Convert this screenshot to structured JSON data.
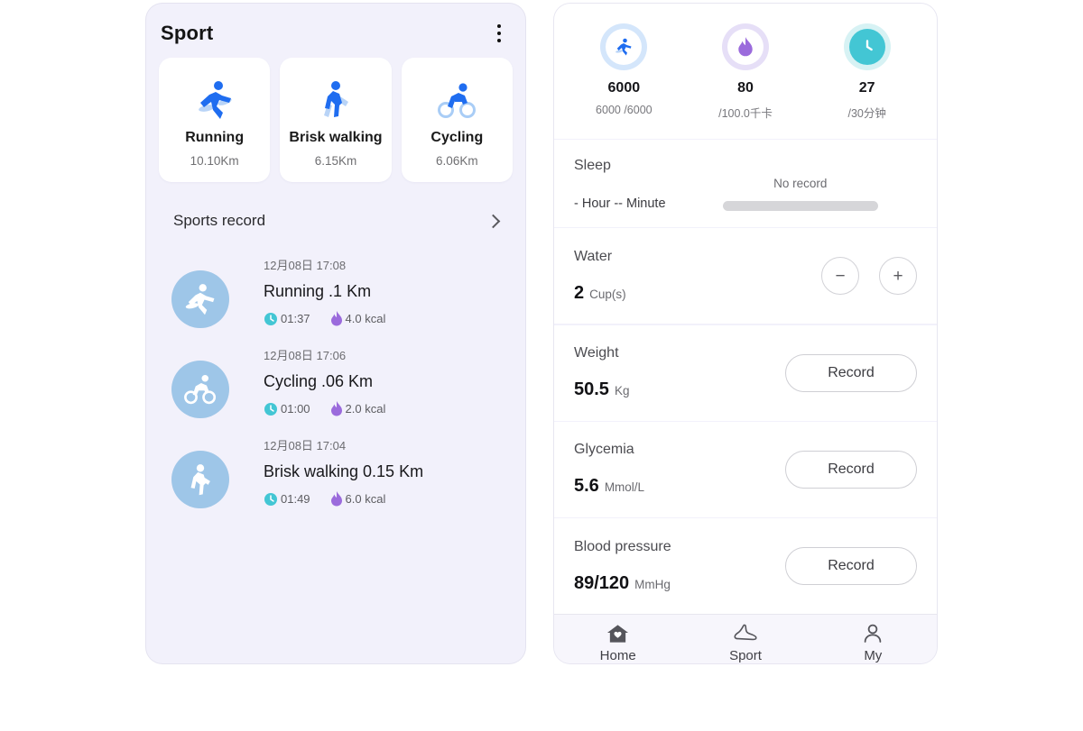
{
  "left": {
    "title": "Sport",
    "menu_icon": "kebab-menu-icon",
    "sport_cards": [
      {
        "icon": "running-icon",
        "name": "Running",
        "distance": "10.10Km"
      },
      {
        "icon": "walking-icon",
        "name": "Brisk walking",
        "distance": "6.15Km"
      },
      {
        "icon": "cycling-icon",
        "name": "Cycling",
        "distance": "6.06Km"
      }
    ],
    "record_section": {
      "title": "Sports record",
      "chevron_icon": "chevron-right-icon"
    },
    "records": [
      {
        "icon": "running-icon",
        "date": "12月08日 17:08",
        "title": "Running  .1 Km",
        "duration": "01:37",
        "calories": "4.0 kcal",
        "clock_icon": "clock-icon",
        "flame_icon": "flame-icon"
      },
      {
        "icon": "cycling-icon",
        "date": "12月08日 17:06",
        "title": "Cycling  .06 Km",
        "duration": "01:00",
        "calories": "2.0 kcal",
        "clock_icon": "clock-icon",
        "flame_icon": "flame-icon"
      },
      {
        "icon": "walking-icon",
        "date": "12月08日 17:04",
        "title": "Brisk walking 0.15 Km",
        "duration": "01:49",
        "calories": "6.0 kcal",
        "clock_icon": "clock-icon",
        "flame_icon": "flame-icon"
      }
    ]
  },
  "right": {
    "metrics": [
      {
        "icon": "running-icon",
        "value": "6000",
        "sub": "6000 /6000"
      },
      {
        "icon": "flame-icon",
        "value": "80",
        "sub": "/100.0千卡"
      },
      {
        "icon": "clock-icon",
        "value": "27",
        "sub": "/30分钟"
      }
    ],
    "sleep": {
      "label": "Sleep",
      "duration": "- Hour -- Minute",
      "status": "No record"
    },
    "water": {
      "label": "Water",
      "value": "2",
      "unit": "Cup(s)",
      "minus_label": "−",
      "plus_label": "+"
    },
    "rows": [
      {
        "label": "Weight",
        "value": "50.5",
        "unit": "Kg",
        "button": "Record"
      },
      {
        "label": "Glycemia",
        "value": "5.6",
        "unit": "Mmol/L",
        "button": "Record"
      },
      {
        "label": "Blood pressure",
        "value": "89/120",
        "unit": "MmHg",
        "button": "Record"
      }
    ],
    "tabs": [
      {
        "icon": "home-icon",
        "label": "Home"
      },
      {
        "icon": "shoe-icon",
        "label": "Sport"
      },
      {
        "icon": "person-icon",
        "label": "My"
      }
    ]
  },
  "colors": {
    "panel_bg": "#f2f1fb",
    "accent_blue": "#1f6df0",
    "avatar_blue": "#9ec6e8",
    "cyan": "#43c6d4",
    "purple": "#9b6bdc"
  }
}
